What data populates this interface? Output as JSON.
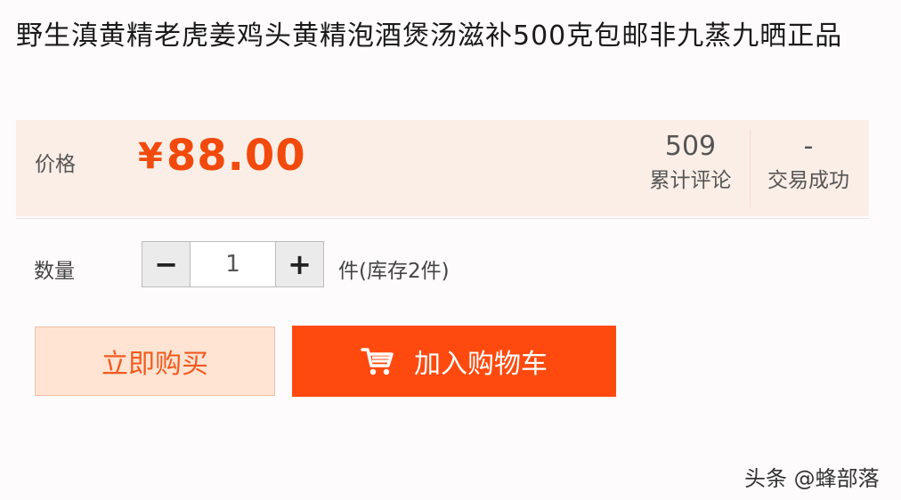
{
  "product": {
    "title": "野生滇黄精老虎姜鸡头黄精泡酒煲汤滋补500克包邮非九蒸九晒正品"
  },
  "price_panel": {
    "label": "价格",
    "currency_symbol": "¥",
    "price": "88.00",
    "reviews_count": "509",
    "reviews_label": "累计评论",
    "trades_count": "-",
    "trades_label": "交易成功"
  },
  "quantity": {
    "label": "数量",
    "minus_label": "−",
    "value": "1",
    "plus_label": "+",
    "stock_text": "件(库存2件)"
  },
  "actions": {
    "buy_now_label": "立即购买",
    "add_to_cart_label": "加入购物车"
  },
  "watermark": "头条 @蜂部落",
  "colors": {
    "accent": "#ff4a0f",
    "price": "#f24a0c",
    "panel_bg": "#fbeee6"
  }
}
